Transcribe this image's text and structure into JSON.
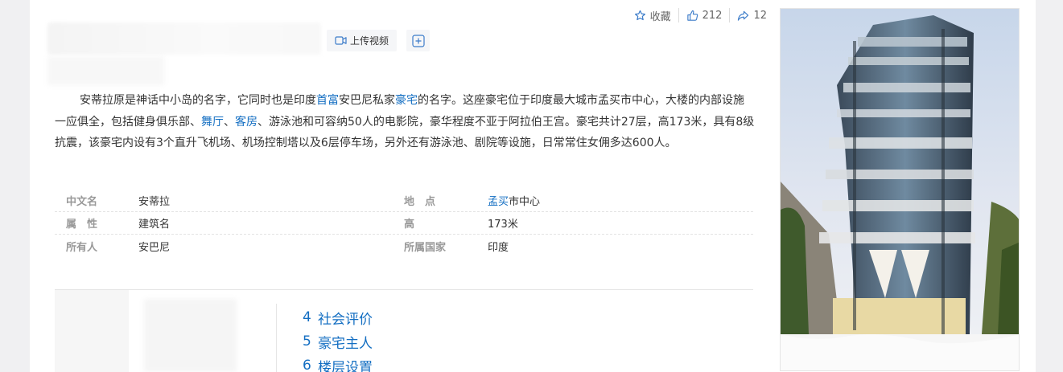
{
  "toolbar": {
    "collect_label": "收藏",
    "like_count": "212",
    "share_count": "12"
  },
  "header": {
    "upload_video_label": "上传视频"
  },
  "summary": {
    "p1": "安蒂拉原是神话中小岛的名字，它同时也是印度",
    "link1": "首富",
    "p2": "安巴尼私家",
    "link2": "豪宅",
    "p3": "的名字。这座豪宅位于印度最大城市孟买市中心，大楼的内部设施一应俱全，包括健身俱乐部、",
    "link3": "舞厅",
    "p4": "、",
    "link4": "客房",
    "p5": "、游泳池和可容纳50人的电影院，豪华程度不亚于阿拉伯王宫。豪宅共计27层，高173米，具有8级抗震，该豪宅内设有3个直升飞机场、机场控制塔以及6层停车场，另外还有游泳池、剧院等设施，日常常住女佣多达600人。"
  },
  "basic_info": {
    "r1": {
      "n1": "中文名",
      "v1": "安蒂拉",
      "n2": "地　点",
      "v2_link": "孟买",
      "v2_rest": "市中心"
    },
    "r2": {
      "n1": "属　性",
      "v1": "建筑名",
      "n2": "高",
      "v2": "173米"
    },
    "r3": {
      "n1": "所有人",
      "v1": "安巴尼",
      "n2": "所属国家",
      "v2": "印度"
    }
  },
  "catalog": {
    "items": [
      {
        "num": "4",
        "label": "社会评价"
      },
      {
        "num": "5",
        "label": "豪宅主人"
      },
      {
        "num": "6",
        "label": "楼层设置"
      }
    ]
  },
  "colors": {
    "link": "#136ec2",
    "toolbar_icon": "#3c7cc9"
  },
  "icons": [
    "star-icon",
    "thumb-up-icon",
    "share-icon",
    "video-icon",
    "plus-box-icon"
  ]
}
